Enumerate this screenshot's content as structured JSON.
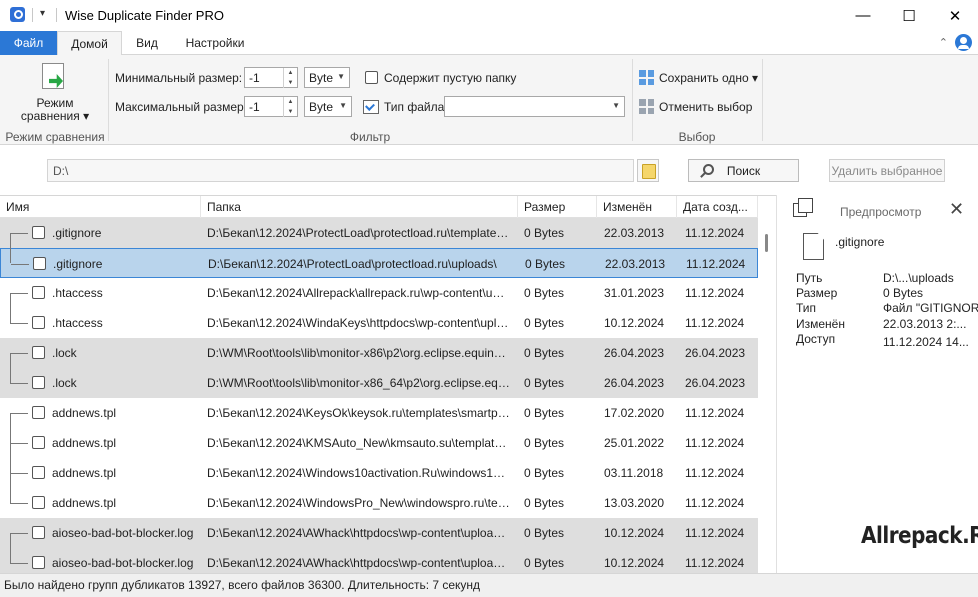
{
  "window": {
    "title": "Wise Duplicate Finder PRO",
    "minimize": "—",
    "maximize": "☐",
    "close": "✕",
    "qa_arrow": "▾"
  },
  "tabs": [
    {
      "label": "Файл"
    },
    {
      "label": "Домой"
    },
    {
      "label": "Вид"
    },
    {
      "label": "Настройки"
    }
  ],
  "tab_collapse": "⌃",
  "ribbon": {
    "compare_mode": {
      "label": "Режим сравнения ▾",
      "group": "Режим сравнения"
    },
    "filter": {
      "group": "Фильтр",
      "min_size_label": "Минимальный размер:",
      "min_size_value": "-1",
      "min_size_unit": "Byte",
      "max_size_label": "Максимальный размер:",
      "max_size_value": "-1",
      "max_size_unit": "Byte",
      "empty_folder_label": "Содержит пустую папку",
      "file_type_label": "Тип файла",
      "file_type_value": ""
    },
    "selection": {
      "group": "Выбор",
      "keep_one": "Сохранить одно ▾",
      "deselect": "Отменить выбор"
    }
  },
  "pathbar": {
    "path": "D:\\",
    "search": "Поиск",
    "delete_selected": "Удалить выбранное"
  },
  "table": {
    "columns": [
      "Имя",
      "Папка",
      "Размер",
      "Изменён",
      "Дата созд..."
    ],
    "rows": [
      {
        "name": ".gitignore",
        "folder": "D:\\Бекап\\12.2024\\ProtectLoad\\protectload.ru\\templates\\ja...",
        "size": "0 Bytes",
        "modified": "22.03.2013",
        "created": "11.12.2024"
      },
      {
        "name": ".gitignore",
        "folder": "D:\\Бекап\\12.2024\\ProtectLoad\\protectload.ru\\uploads\\",
        "size": "0 Bytes",
        "modified": "22.03.2013",
        "created": "11.12.2024"
      },
      {
        "name": ".htaccess",
        "folder": "D:\\Бекап\\12.2024\\Allrepack\\allrepack.ru\\wp-content\\uploads\\",
        "size": "0 Bytes",
        "modified": "31.01.2023",
        "created": "11.12.2024"
      },
      {
        "name": ".htaccess",
        "folder": "D:\\Бекап\\12.2024\\WindaKeys\\httpdocs\\wp-content\\uploads\\",
        "size": "0 Bytes",
        "modified": "10.12.2024",
        "created": "11.12.2024"
      },
      {
        "name": ".lock",
        "folder": "D:\\WM\\Root\\tools\\lib\\monitor-x86\\p2\\org.eclipse.equinox.p...",
        "size": "0 Bytes",
        "modified": "26.04.2023",
        "created": "26.04.2023"
      },
      {
        "name": ".lock",
        "folder": "D:\\WM\\Root\\tools\\lib\\monitor-x86_64\\p2\\org.eclipse.equino...",
        "size": "0 Bytes",
        "modified": "26.04.2023",
        "created": "26.04.2023"
      },
      {
        "name": "addnews.tpl",
        "folder": "D:\\Бекап\\12.2024\\KeysOk\\keysok.ru\\templates\\smartphone\\",
        "size": "0 Bytes",
        "modified": "17.02.2020",
        "created": "11.12.2024"
      },
      {
        "name": "addnews.tpl",
        "folder": "D:\\Бекап\\12.2024\\KMSAuto_New\\kmsauto.su\\templates\\sm...",
        "size": "0 Bytes",
        "modified": "25.01.2022",
        "created": "11.12.2024"
      },
      {
        "name": "addnews.tpl",
        "folder": "D:\\Бекап\\12.2024\\Windows10activation.Ru\\windows10activ...",
        "size": "0 Bytes",
        "modified": "03.11.2018",
        "created": "11.12.2024"
      },
      {
        "name": "addnews.tpl",
        "folder": "D:\\Бекап\\12.2024\\WindowsPro_New\\windowspro.ru\\templa...",
        "size": "0 Bytes",
        "modified": "13.03.2020",
        "created": "11.12.2024"
      },
      {
        "name": "aioseo-bad-bot-blocker.log",
        "folder": "D:\\Бекап\\12.2024\\AWhack\\httpdocs\\wp-content\\uploads\\ai...",
        "size": "0 Bytes",
        "modified": "10.12.2024",
        "created": "11.12.2024"
      },
      {
        "name": "aioseo-bad-bot-blocker.log",
        "folder": "D:\\Бекап\\12.2024\\AWhack\\httpdocs\\wp-content\\uploads\\ai...",
        "size": "0 Bytes",
        "modified": "10.12.2024",
        "created": "11.12.2024"
      }
    ]
  },
  "preview": {
    "title": "Предпросмотр",
    "close": "✕",
    "file_name": ".gitignore",
    "fields": [
      {
        "key": "Путь",
        "value": "D:\\...\\uploads"
      },
      {
        "key": "Размер",
        "value": "0 Bytes"
      },
      {
        "key": "Тип",
        "value": "Файл \"GITIGNORE\""
      },
      {
        "key": "Изменён",
        "value": "22.03.2013 2:..."
      },
      {
        "key": "Доступ",
        "value": "11.12.2024 14..."
      }
    ],
    "watermark": "Allrepack.Ru"
  },
  "status": {
    "text": "Было найдено групп дубликатов 13927, всего файлов 36300. Длительность: 7 секунд"
  }
}
